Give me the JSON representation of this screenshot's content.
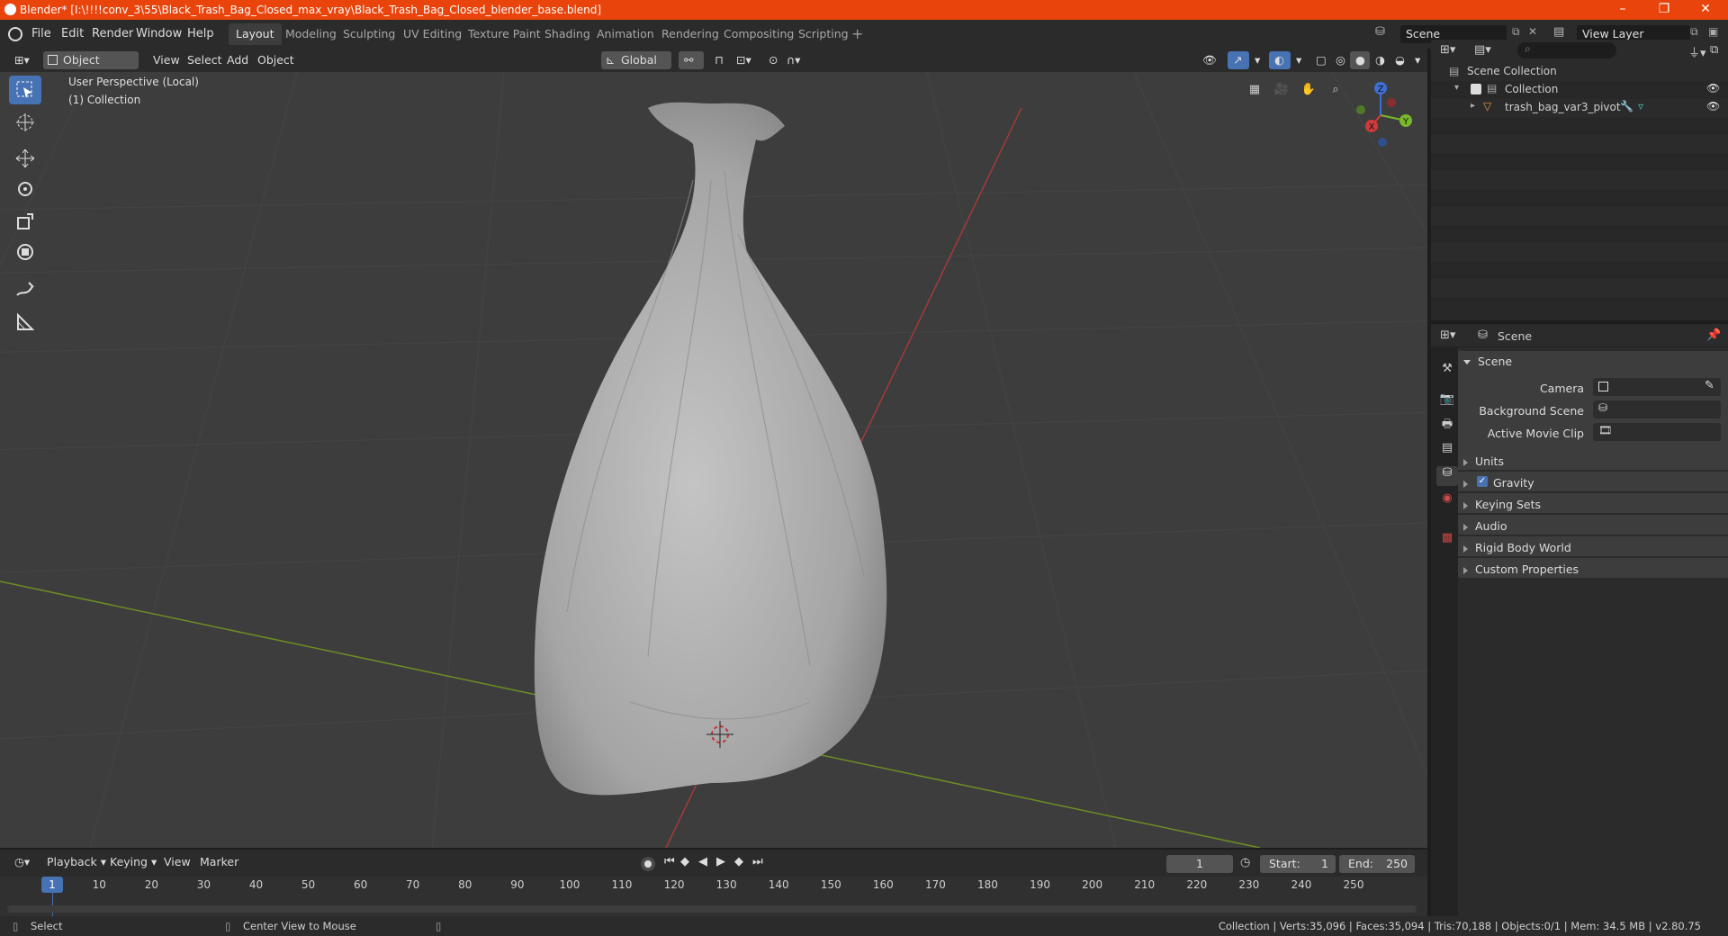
{
  "window": {
    "title": "Blender* [I:\\!!!!conv_3\\55\\Black_Trash_Bag_Closed_max_vray\\Black_Trash_Bag_Closed_blender_base.blend]",
    "accent": "#e8440c"
  },
  "menu": [
    "File",
    "Edit",
    "Render",
    "Window",
    "Help"
  ],
  "workspaces": [
    "Layout",
    "Modeling",
    "Sculpting",
    "UV Editing",
    "Texture Paint",
    "Shading",
    "Animation",
    "Rendering",
    "Compositing",
    "Scripting"
  ],
  "active_workspace": "Layout",
  "scene_field": "Scene",
  "view_layer_field": "View Layer",
  "viewport_header": {
    "mode": "Object Mode",
    "menus": [
      "View",
      "Select",
      "Add",
      "Object"
    ],
    "orientation": "Global"
  },
  "viewport": {
    "overlay_line1": "User Perspective (Local)",
    "overlay_line2": "(1) Collection",
    "gizmo": {
      "z": "Z",
      "y": "Y",
      "x": "X"
    }
  },
  "outliner": {
    "root": "Scene Collection",
    "collection": "Collection",
    "object": "trash_bag_var3_pivot"
  },
  "properties": {
    "header": "Scene",
    "panel": "Scene",
    "camera_label": "Camera",
    "background_scene_label": "Background Scene",
    "active_movie_clip_label": "Active Movie Clip",
    "sections": [
      "Units",
      "Gravity",
      "Keying Sets",
      "Audio",
      "Rigid Body World",
      "Custom Properties"
    ]
  },
  "timeline": {
    "menus": [
      "Playback",
      "Keying",
      "View",
      "Marker"
    ],
    "current_frame": "1",
    "start_label": "Start:",
    "start": "1",
    "end_label": "End:",
    "end": "250",
    "ticks": [
      "1",
      "10",
      "20",
      "30",
      "40",
      "50",
      "60",
      "70",
      "80",
      "90",
      "100",
      "110",
      "120",
      "130",
      "140",
      "150",
      "160",
      "170",
      "180",
      "190",
      "200",
      "210",
      "220",
      "230",
      "240",
      "250"
    ]
  },
  "statusbar": {
    "left": "Select",
    "middle": "Center View to Mouse",
    "right": "Collection | Verts:35,096 | Faces:35,094 | Tris:70,188 | Objects:0/1 | Mem: 34.5 MB | v2.80.75"
  }
}
